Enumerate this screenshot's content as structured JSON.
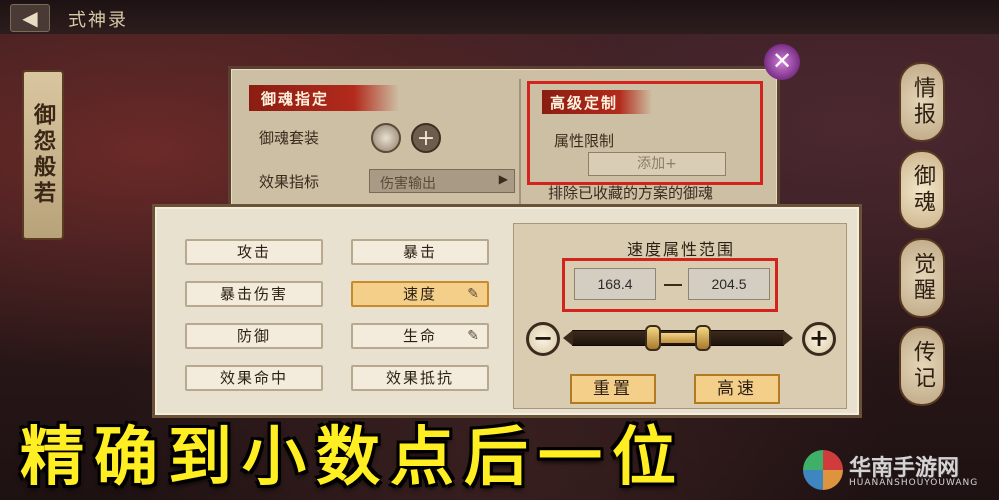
{
  "header": {
    "back_icon": "back-arrow-icon",
    "title": "式神录"
  },
  "left_tab": {
    "label": "御怨般若"
  },
  "right_nav": {
    "items": [
      "情报",
      "御魂",
      "觉醒",
      "传记"
    ]
  },
  "back_panel": {
    "section_title": "御魂指定",
    "set_label": "御魂套装",
    "effect_label": "效果指标",
    "effect_value": "伤害输出",
    "advanced_title": "高级定制",
    "attr_limit_label": "属性限制",
    "add_button": "添加+",
    "exclude_text": "排除已收藏的方案的御魂"
  },
  "stats": [
    {
      "label": "攻击",
      "selected": false,
      "pen": false
    },
    {
      "label": "暴击",
      "selected": false,
      "pen": false
    },
    {
      "label": "暴击伤害",
      "selected": false,
      "pen": false
    },
    {
      "label": "速度",
      "selected": true,
      "pen": true
    },
    {
      "label": "防御",
      "selected": false,
      "pen": false
    },
    {
      "label": "生命",
      "selected": false,
      "pen": true
    },
    {
      "label": "效果命中",
      "selected": false,
      "pen": false
    },
    {
      "label": "效果抵抗",
      "selected": false,
      "pen": false
    }
  ],
  "range": {
    "title": "速度属性范围",
    "min": "168.4",
    "separator": "—",
    "max": "204.5",
    "slider_low_fraction": 0.38,
    "slider_high_fraction": 0.62
  },
  "actions": {
    "reset": "重置",
    "fast": "高速"
  },
  "caption": "精确到小数点后一位",
  "watermark": {
    "name": "华南手游网",
    "sub": "HUANANSHOUYOUWANG"
  },
  "colors": {
    "highlight_red": "#d2241c",
    "caption_yellow": "#ffee22",
    "selected_gold": "#f4cf8a"
  }
}
